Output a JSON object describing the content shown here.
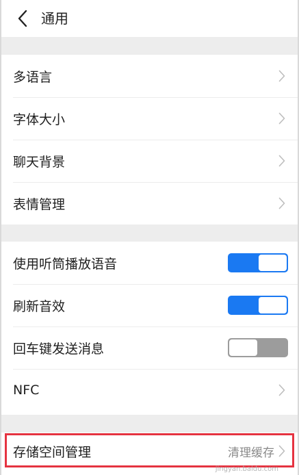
{
  "header": {
    "title": "通用"
  },
  "group1": {
    "items": [
      {
        "label": "多语言"
      },
      {
        "label": "字体大小"
      },
      {
        "label": "聊天背景"
      },
      {
        "label": "表情管理"
      }
    ]
  },
  "group2": {
    "items": [
      {
        "label": "使用听筒播放语音",
        "switch": "on"
      },
      {
        "label": "刷新音效",
        "switch": "on"
      },
      {
        "label": "回车键发送消息",
        "switch": "off"
      },
      {
        "label": "NFC"
      }
    ]
  },
  "group3": {
    "items": [
      {
        "label": "存储空间管理",
        "value": "清理缓存"
      }
    ]
  },
  "watermark": "jingyan.baidu.com",
  "colors": {
    "accent": "#1a79f2",
    "highlight": "#e53340",
    "background": "#ededed"
  }
}
